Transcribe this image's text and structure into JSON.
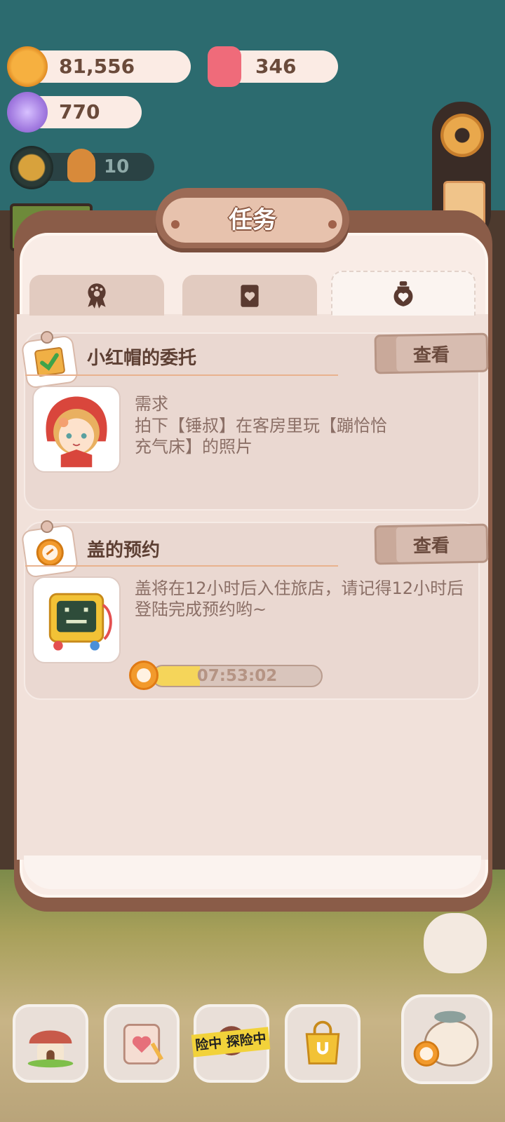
{
  "currencies": {
    "cookies": "81,556",
    "gems": "346",
    "candy": "770",
    "gingerbread": "10"
  },
  "panel": {
    "title": "任务"
  },
  "tabs": [
    {
      "icon": "paw-badge-icon",
      "active": false
    },
    {
      "icon": "paper-heart-icon",
      "active": false
    },
    {
      "icon": "bottle-heart-icon",
      "active": true
    }
  ],
  "tasks": [
    {
      "title": "小红帽的委托",
      "view_label": "查看",
      "requirement_label": "需求",
      "description": "拍下【锤叔】在客房里玩【蹦恰恰充气床】的照片",
      "badge_icon": "checklist-icon",
      "avatar_icon": "red-riding-hood-avatar"
    },
    {
      "title": "盖的预约",
      "view_label": "查看",
      "description": "盖将在12小时后入住旅店，请记得12小时后登陆完成预约哟~",
      "badge_icon": "alarm-clock-icon",
      "avatar_icon": "robot-gai-avatar",
      "countdown": "07:53:02",
      "countdown_progress": 0.28
    }
  ],
  "bottom_nav": {
    "adventure_tape": "险中 探险中"
  },
  "colors": {
    "panel_frame": "#8a5c48",
    "panel_bg": "#f9ece6",
    "card_bg": "#ead8d1",
    "accent_line": "#e9b28e",
    "timer_fill": "#f5d55a",
    "title_text": "#5d3f33"
  }
}
